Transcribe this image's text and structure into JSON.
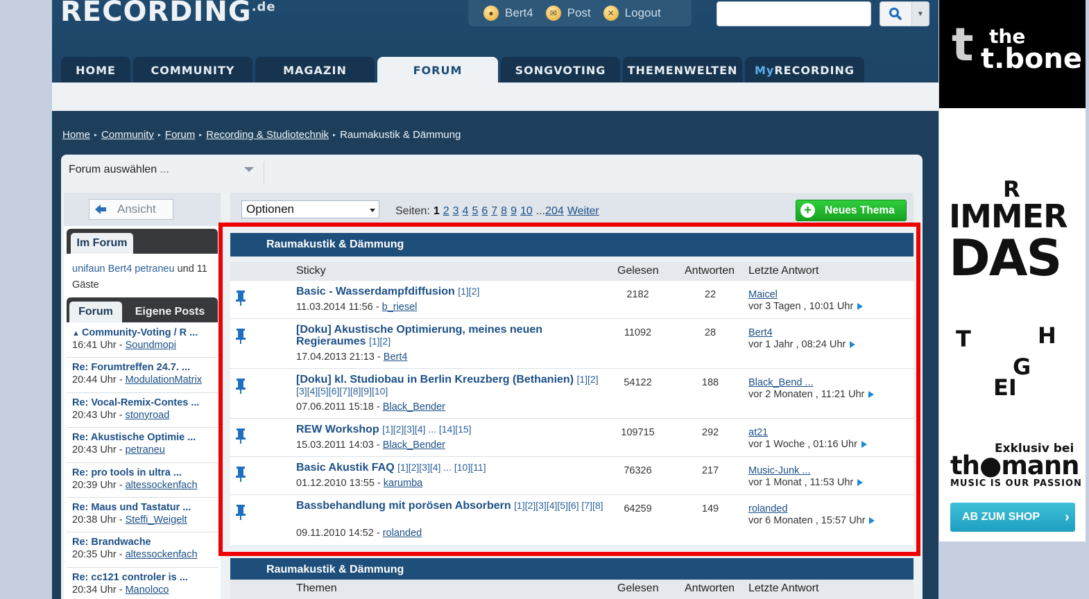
{
  "header": {
    "logo": "RECORDING",
    "logo_tld": ".de",
    "user": "Bert4",
    "post": "Post",
    "logout": "Logout",
    "search_placeholder": ""
  },
  "nav": {
    "tabs": [
      {
        "label": "HOME"
      },
      {
        "label": "COMMUNITY"
      },
      {
        "label": "MAGAZIN"
      },
      {
        "label": "FORUM"
      },
      {
        "label": "SONGVOTING"
      },
      {
        "label": "THEMENWELTEN"
      },
      {
        "label_prefix": "My",
        "label": "RECORDING"
      }
    ]
  },
  "breadcrumb": [
    "Home",
    "Community",
    "Forum",
    "Recording & Studiotechnik",
    "Raumakustik & Dämmung"
  ],
  "forum_select": {
    "label": "Forum auswählen",
    "dots": " ..."
  },
  "sidebar": {
    "ansicht": "Ansicht",
    "im_forum_tab": "Im Forum",
    "online_users": "unifaun Bert4 petraneu",
    "online_rest": "und 11 Gäste",
    "tab_forum": "Forum",
    "tab_eigene": "Eigene Posts",
    "latest": [
      {
        "title": "Community-Voting / R ...",
        "time": "16:41 Uhr - ",
        "user": "Soundmopi",
        "arrow": "🠕"
      },
      {
        "title": "Re: Forumtreffen 24.7. ...",
        "time": "20:44 Uhr - ",
        "user": "ModulationMatrix"
      },
      {
        "title": "Re: Vocal-Remix-Contes ...",
        "time": "20:43 Uhr - ",
        "user": "stonyroad"
      },
      {
        "title": "Re: Akustische Optimie ...",
        "time": "20:43 Uhr - ",
        "user": "petraneu"
      },
      {
        "title": "Re: pro tools in ultra ...",
        "time": "20:39 Uhr - ",
        "user": "altessockenfach"
      },
      {
        "title": "Re: Maus und Tastatur ...",
        "time": "20:38 Uhr - ",
        "user": "Steffi_Weigelt"
      },
      {
        "title": "Re: Brandwache",
        "time": "20:35 Uhr - ",
        "user": "altessockenfach"
      },
      {
        "title": "Re: cc121 controler is ...",
        "time": "20:34 Uhr - ",
        "user": "Manoloco"
      }
    ]
  },
  "toolbar": {
    "optionen": "Optionen",
    "pages_label": "Seiten:",
    "current_page": "1",
    "pages": [
      "2",
      "3",
      "4",
      "5",
      "6",
      "7",
      "8",
      "9",
      "10"
    ],
    "ellipsis": "...",
    "last_page": "204",
    "next": "Weiter",
    "new_topic": "Neues Thema"
  },
  "section": {
    "title": "Raumakustik & Dämmung",
    "col_sticky": "Sticky",
    "col_themen": "Themen",
    "col_gelesen": "Gelesen",
    "col_antworten": "Antworten",
    "col_letzte": "Letzte Antwort"
  },
  "threads": [
    {
      "title": "Basic - Wasserdampfdiffusion",
      "pages": "[1][2]",
      "date": "11.03.2014 11:56 - ",
      "author": "b_riesel",
      "read": "2182",
      "answers": "22",
      "last_user": "Maicel",
      "last_time": "vor 3 Tagen , 10:01 Uhr"
    },
    {
      "title": "[Doku] Akustische Optimierung, meines neuen Regieraumes",
      "pages": "[1][2]",
      "date": "17.04.2013 21:13 - ",
      "author": "Bert4",
      "read": "11092",
      "answers": "28",
      "last_user": "Bert4",
      "last_time": "vor 1 Jahr , 08:24 Uhr"
    },
    {
      "title": "[Doku] kl. Studiobau in Berlin Kreuzberg (Bethanien)",
      "pages": "[1][2] [3][4][5][6][7][8][9][10]",
      "date": "07.06.2011 15:18 - ",
      "author": "Black_Bender",
      "read": "54122",
      "answers": "188",
      "last_user": "Black_Bend ...",
      "last_time": "vor 2 Monaten , 11:21 Uhr"
    },
    {
      "title": "REW Workshop",
      "pages": "[1][2][3][4] ... [14][15]",
      "date": "15.03.2011 14:03 - ",
      "author": "Black_Bender",
      "read": "109715",
      "answers": "292",
      "last_user": "at21",
      "last_time": "vor 1 Woche , 01:16 Uhr"
    },
    {
      "title": "Basic Akustik FAQ",
      "pages": "[1][2][3][4] ... [10][11]",
      "date": "01.12.2010 13:55 - ",
      "author": "karumba",
      "read": "76326",
      "answers": "217",
      "last_user": "Music-Junk ...",
      "last_time": "vor 1 Monat , 11:53 Uhr"
    },
    {
      "title": "Bassbehandlung mit porösen Absorbern",
      "pages": "[1][2][3][4][5][6] [7][8]",
      "date": "09.11.2010 14:52 - ",
      "author": "rolanded",
      "read": "64259",
      "answers": "149",
      "last_user": "rolanded",
      "last_time": "vor 6 Monaten , 15:57 Uhr"
    }
  ],
  "ad": {
    "the": "the",
    "tbone": "t.bone",
    "r": "R",
    "immer": "IMMER",
    "das": "DAS",
    "t": "T",
    "h": "H",
    "g": "G",
    "ei": "EI",
    "exklusiv": "Exklusiv bei",
    "thomann": "th●mann",
    "slogan": "MUSIC IS OUR PASSION",
    "shop": "AB ZUM SHOP"
  },
  "colors": {
    "accent": "#1d4f7a",
    "header": "#1f4a6e",
    "highlight": "#ee0000",
    "new_topic": "#17a321"
  }
}
